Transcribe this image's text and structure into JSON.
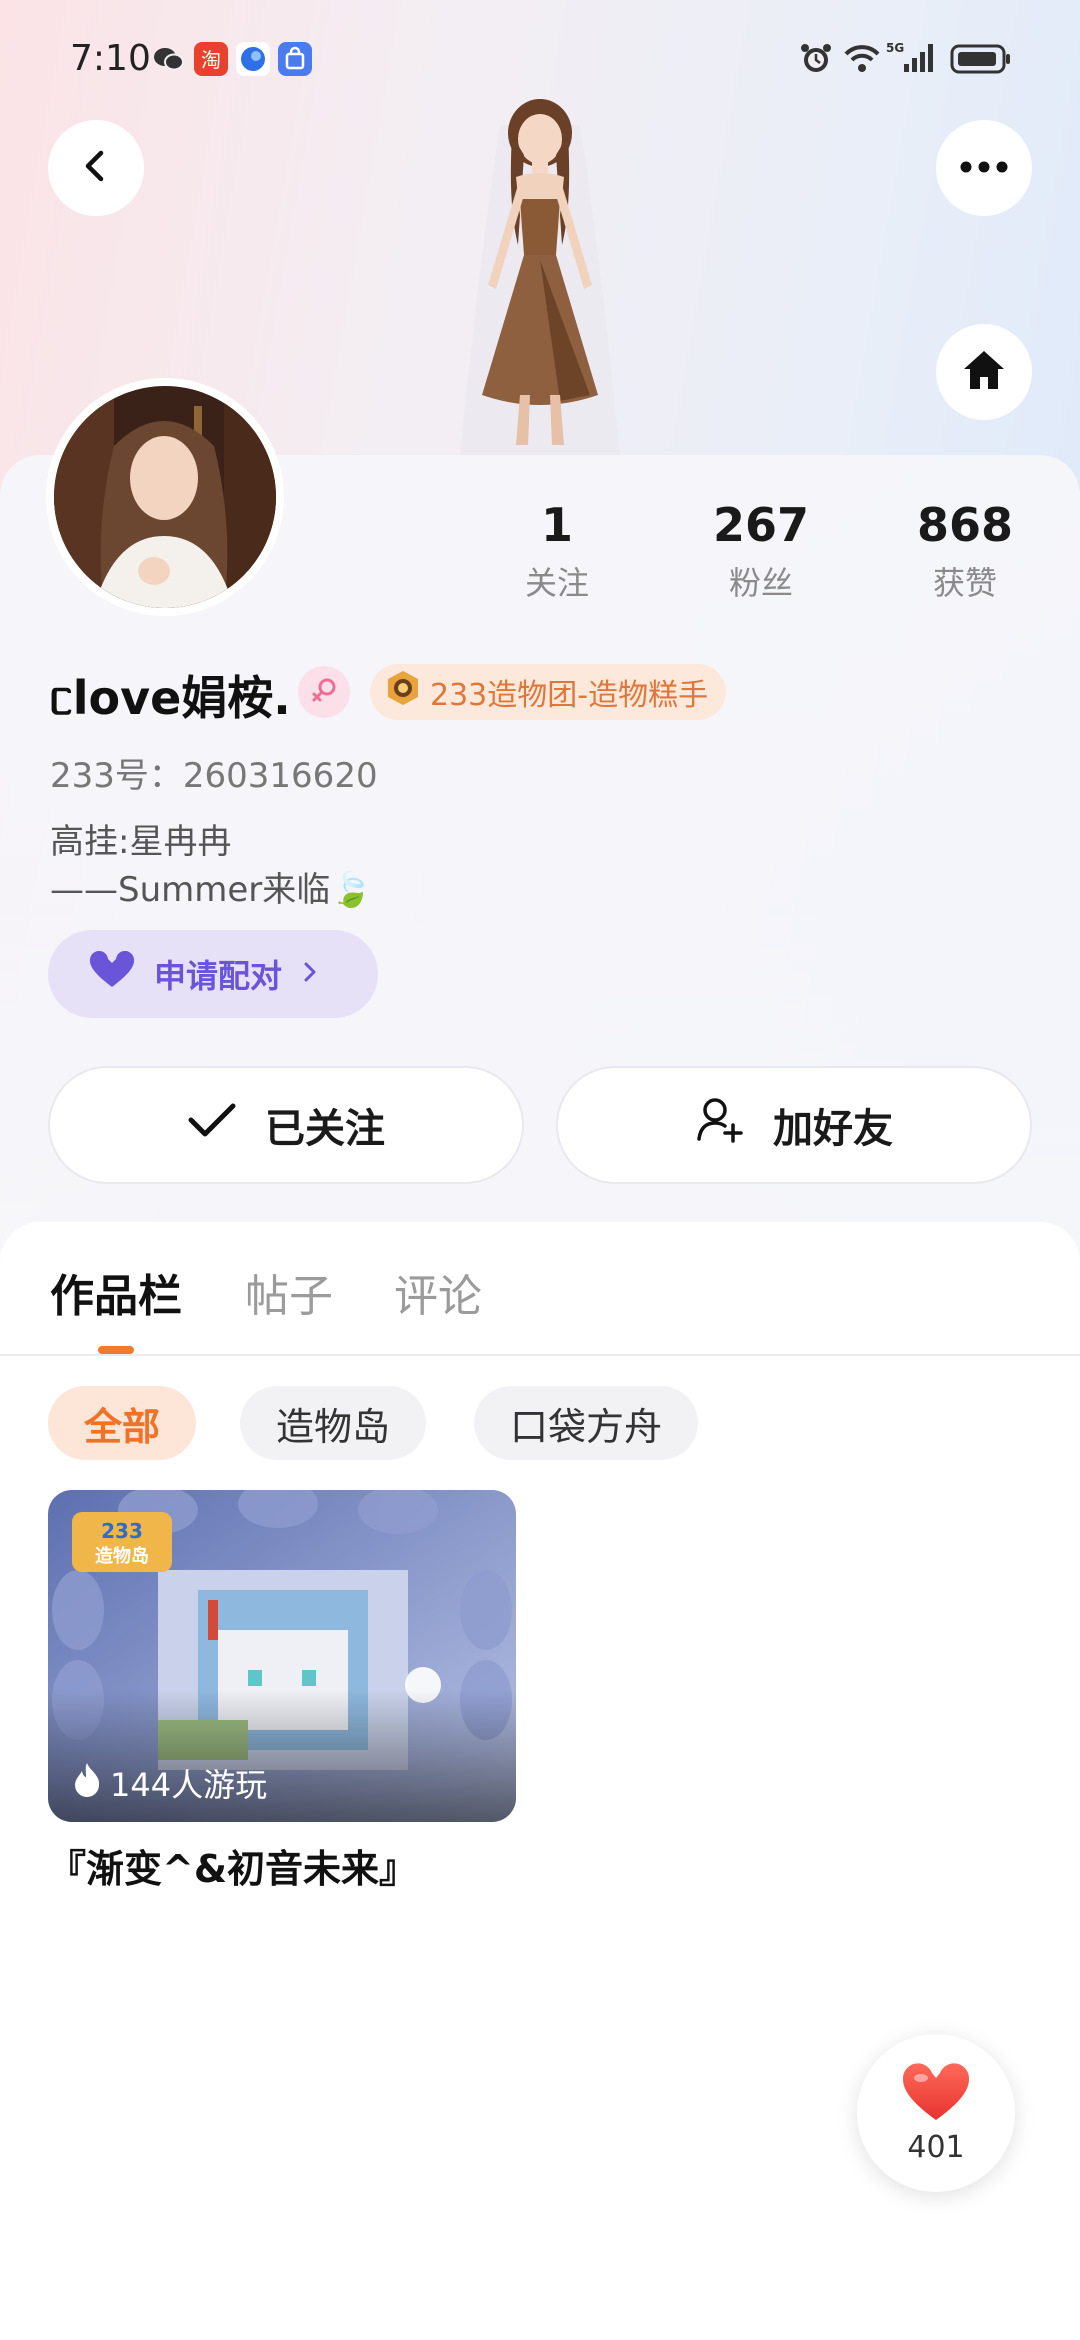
{
  "status_bar": {
    "time": "7:10",
    "icons": [
      "wechat-icon",
      "taobao-icon",
      "browser-icon",
      "shopping-bag-icon",
      "alarm-icon",
      "wifi-icon",
      "signal-5g-icon",
      "battery-icon"
    ]
  },
  "header": {
    "back_icon": "chevron-left-icon",
    "more_icon": "more-dots-icon",
    "home_icon": "home-icon"
  },
  "profile": {
    "nickname": "ᥴlove娟桉.",
    "gender_icon": "female-icon",
    "group_badge": "233造物团-造物糕手",
    "uid": "233号：260316620",
    "bio_line1": "高挂:星冉冉",
    "bio_line2": "——Summer来临🍃",
    "stats": [
      {
        "value": "1",
        "label": "关注"
      },
      {
        "value": "267",
        "label": "粉丝"
      },
      {
        "value": "868",
        "label": "获赞"
      }
    ],
    "pair_button": "申请配对",
    "follow_button": "已关注",
    "add_friend_button": "加好友"
  },
  "tabs": [
    {
      "label": "作品栏",
      "active": true
    },
    {
      "label": "帖子",
      "active": false
    },
    {
      "label": "评论",
      "active": false
    }
  ],
  "filters": [
    {
      "label": "全部",
      "active": true
    },
    {
      "label": "造物岛",
      "active": false
    },
    {
      "label": "口袋方舟",
      "active": false
    }
  ],
  "works": [
    {
      "title": "『渐变^&初音未来』",
      "players": "144人游玩",
      "logo_text": "233造物岛"
    }
  ],
  "like_fab": {
    "count": "401"
  },
  "colors": {
    "accent_orange": "#ef7228",
    "pair_purple": "#6a54d8",
    "like_red": "#f0453f"
  }
}
